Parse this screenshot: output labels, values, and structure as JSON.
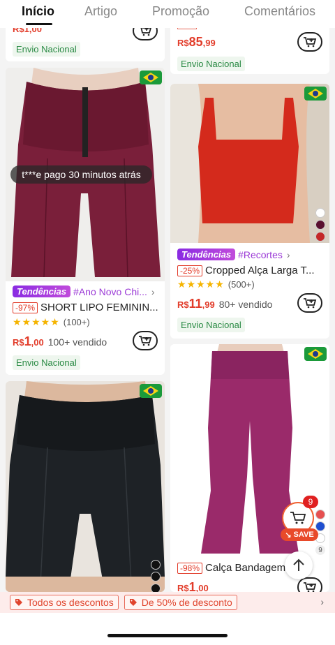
{
  "tabs": [
    {
      "label": "Início",
      "active": true
    },
    {
      "label": "Artigo",
      "active": false
    },
    {
      "label": "Promoção",
      "active": false
    },
    {
      "label": "Comentários",
      "active": false
    }
  ],
  "partial_top_left": {
    "price_prefix": "R$",
    "price": "1,00",
    "shipping": "Envio Nacional"
  },
  "partial_top_right": {
    "currency": "R$",
    "price": "85",
    "cents": ",99",
    "shipping": "Envio Nacional"
  },
  "product_short": {
    "badge": "Tendências",
    "tag": "#Ano Novo Chi...",
    "discount": "-97%",
    "title": "SHORT LIPO FEMININ...",
    "stars": "★★★★★",
    "reviews": "(100+)",
    "currency": "R$",
    "price": "1",
    "cents": ",00",
    "sold": "100+ vendido",
    "shipping": "Envio Nacional",
    "toast": "t***e pago 30 minutos atrás",
    "colors": [
      "#7a1f3a",
      "#2a2a2a",
      "#d8c8b8"
    ]
  },
  "product_cropped": {
    "badge": "Tendências",
    "tag": "#Recortes",
    "discount": "-25%",
    "title": "Cropped Alça Larga T...",
    "stars": "★★★★★",
    "reviews": "(500+)",
    "currency": "R$",
    "price": "11",
    "cents": ",99",
    "sold": "80+ vendido",
    "shipping": "Envio Nacional",
    "colors": [
      "#ffffff",
      "#5a1030",
      "#c42828"
    ]
  },
  "product_black_short": {
    "colors": [
      "#111111",
      "#111111",
      "#111111"
    ]
  },
  "product_calca": {
    "discount": "-98%",
    "title": "Calça Bandagem...",
    "currency": "R$",
    "price": "1",
    "cents": ",00"
  },
  "floating_cart": {
    "count": "9",
    "save": "SAVE",
    "extra": "9",
    "colors": [
      "#e65050",
      "#1f4fd0",
      "#ffffff"
    ]
  },
  "bottom_bar": {
    "pills": [
      "Todos os descontos",
      "De 50% de desconto"
    ]
  },
  "colors": {
    "accent": "#e23c2a",
    "tag": "#9b3bd6",
    "ship": "#2a8a44"
  }
}
